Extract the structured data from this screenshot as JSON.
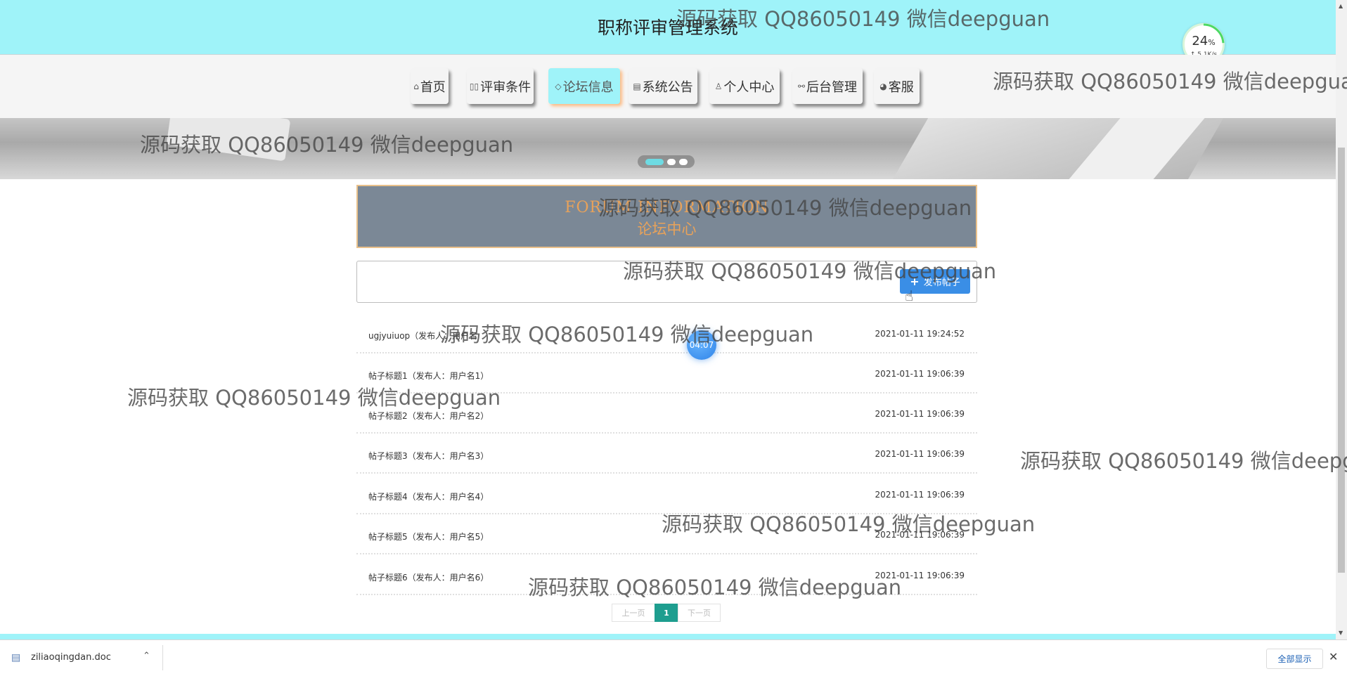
{
  "header": {
    "title": "职称评审管理系统"
  },
  "speed_widget": {
    "percent": "24",
    "percent_unit": "%",
    "rate": "↑ 5.1K/s"
  },
  "nav": {
    "items": [
      {
        "icon": "home-icon",
        "glyph": "⌂",
        "label": "首页"
      },
      {
        "icon": "book-icon",
        "glyph": "▯▯",
        "label": "评审条件"
      },
      {
        "icon": "tag-icon",
        "glyph": "◇",
        "label": "论坛信息",
        "active": true
      },
      {
        "icon": "notice-icon",
        "glyph": "▤",
        "label": "系统公告"
      },
      {
        "icon": "user-icon",
        "glyph": "♙",
        "label": "个人中心"
      },
      {
        "icon": "link-icon",
        "glyph": "⚯",
        "label": "后台管理"
      },
      {
        "icon": "service-icon",
        "glyph": "◕",
        "label": "客服"
      }
    ]
  },
  "banner": {
    "slides": 3,
    "active_slide": 1
  },
  "forum": {
    "title_en": "FORUM INFORMATION",
    "title_cn": "论坛中心"
  },
  "post_button": {
    "label": "发布帖子"
  },
  "posts": [
    {
      "title": "ugjyuiuop（发布人：用户名",
      "time": "2021-01-11 19:24:52"
    },
    {
      "title": "帖子标题1（发布人：用户名1）",
      "time": "2021-01-11 19:06:39"
    },
    {
      "title": "帖子标题2（发布人：用户名2）",
      "time": "2021-01-11 19:06:39"
    },
    {
      "title": "帖子标题3（发布人：用户名3）",
      "time": "2021-01-11 19:06:39"
    },
    {
      "title": "帖子标题4（发布人：用户名4）",
      "time": "2021-01-11 19:06:39"
    },
    {
      "title": "帖子标题5（发布人：用户名5）",
      "time": "2021-01-11 19:06:39"
    },
    {
      "title": "帖子标题6（发布人：用户名6）",
      "time": "2021-01-11 19:06:39"
    }
  ],
  "timer": "04:07",
  "pagination": {
    "prev": "上一页",
    "current": "1",
    "next": "下一页"
  },
  "download_bar": {
    "file_name": "ziliaoqingdan.doc",
    "show_all": "全部显示"
  },
  "watermark": "源码获取 QQ86050149 微信deepguan",
  "colors": {
    "header_bg": "#9ff3f9",
    "accent_button": "#3a8ee6",
    "pager_active": "#1e9e8f",
    "forum_title": "#e8a25a"
  }
}
